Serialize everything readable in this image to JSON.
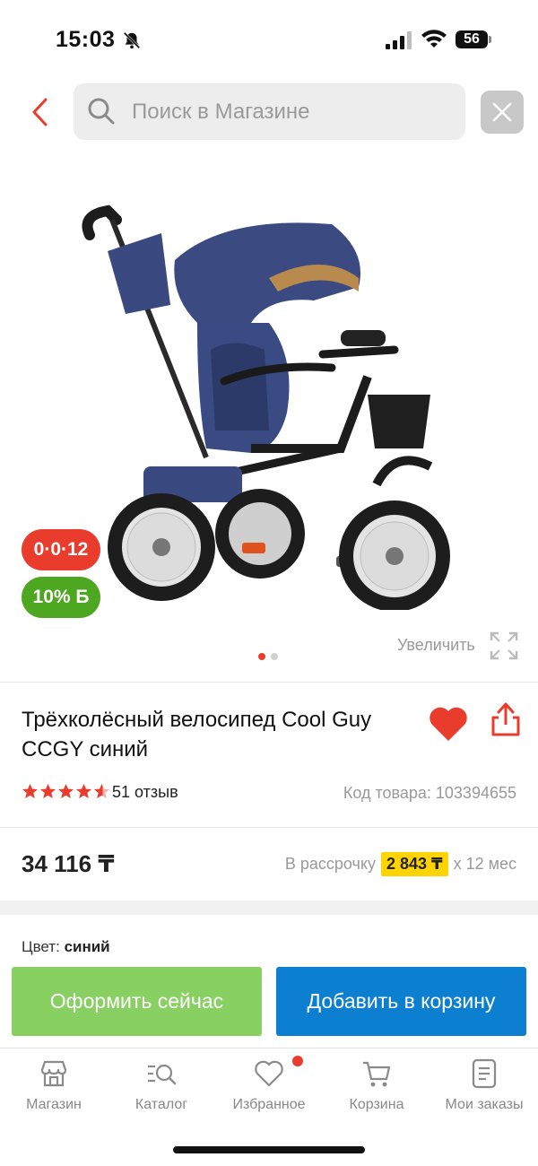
{
  "status_bar": {
    "time": "15:03",
    "battery": "56"
  },
  "search": {
    "placeholder": "Поиск в Магазине"
  },
  "gallery": {
    "badge_installment": "0·0·12",
    "badge_bonus": "10% Б",
    "zoom_label": "Увеличить",
    "slide_count": 2,
    "active_slide": 1
  },
  "product": {
    "title": "Трёхколёсный велосипед Cool Guy CCGY синий",
    "rating": 4.5,
    "reviews": "51 отзыв",
    "sku": "Код товара: 103394655",
    "price": "34 116 ₸",
    "installment_prefix": "В рассрочку",
    "installment_amount": "2 843 ₸",
    "installment_suffix": "х 12 мес",
    "color_label": "Цвет:",
    "color_value": "синий"
  },
  "actions": {
    "order_now": "Оформить сейчас",
    "add_to_cart": "Добавить в корзину"
  },
  "nav": {
    "items": [
      {
        "label": "Магазин",
        "icon": "shop-icon"
      },
      {
        "label": "Каталог",
        "icon": "catalog-search-icon"
      },
      {
        "label": "Избранное",
        "icon": "heart-icon"
      },
      {
        "label": "Корзина",
        "icon": "cart-icon"
      },
      {
        "label": "Мои заказы",
        "icon": "orders-icon"
      }
    ]
  },
  "colors": {
    "accent_red": "#ea3c2d",
    "bonus_green": "#4ea720",
    "order_green": "#89d063",
    "cart_blue": "#0d7fd1",
    "installment_yellow": "#ffd400"
  }
}
